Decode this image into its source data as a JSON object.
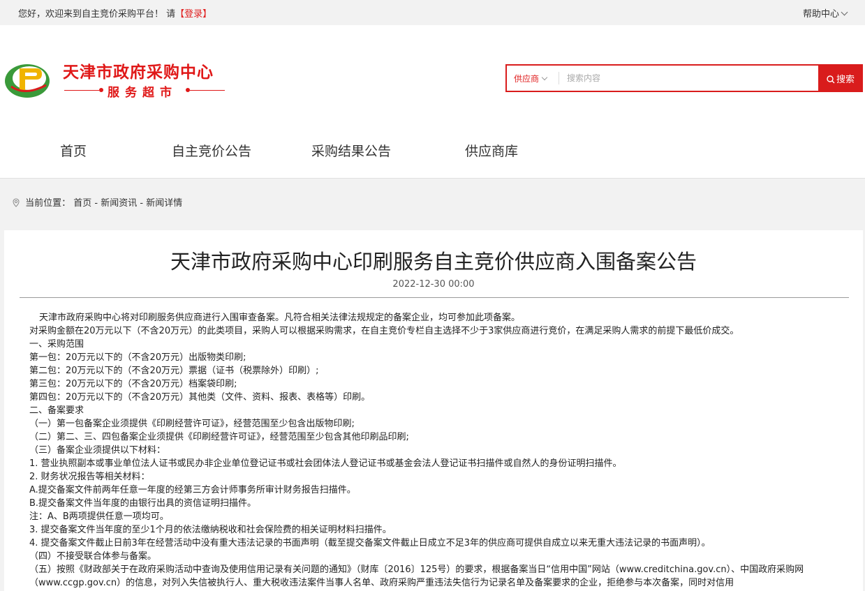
{
  "topbar": {
    "welcome": "您好，欢迎来到自主竞价采购平台！ 请",
    "login": "【登录】",
    "help": "帮助中心"
  },
  "logo": {
    "title": "天津市政府采购中心",
    "subtitle": "服务超市"
  },
  "search": {
    "scope": "供应商",
    "placeholder": "搜索内容",
    "button": "搜索"
  },
  "nav": [
    "首页",
    "自主竞价公告",
    "采购结果公告",
    "供应商库"
  ],
  "breadcrumb": {
    "label": "当前位置：",
    "path": "首页 - 新闻资讯 - 新闻详情"
  },
  "article": {
    "title": "天津市政府采购中心印刷服务自主竞价供应商入围备案公告",
    "date": "2022-12-30 00:00",
    "paragraphs": [
      "天津市政府采购中心将对印刷服务供应商进行入围审查备案。凡符合相关法律法规规定的备案企业，均可参加此项备案。",
      "对采购金额在20万元以下（不含20万元）的此类项目，采购人可以根据采购需求，在自主竞价专栏自主选择不少于3家供应商进行竞价，在满足采购人需求的前提下最低价成交。",
      "一、采购范围",
      "第一包：20万元以下的（不含20万元）出版物类印刷;",
      "第二包：20万元以下的（不含20万元）票据（证书（税票除外）印刷）;",
      "第三包：20万元以下的（不含20万元）档案袋印刷;",
      "第四包：20万元以下的（不含20万元）其他类（文件、资料、报表、表格等）印刷。",
      "二、备案要求",
      "（一）第一包备案企业须提供《印刷经营许可证》，经营范围至少包含出版物印刷;",
      "（二）第二、三、四包备案企业须提供《印刷经营许可证》，经营范围至少包含其他印刷品印刷;",
      "（三）备案企业须提供以下材料：",
      "1. 营业执照副本或事业单位法人证书或民办非企业单位登记证书或社会团体法人登记证书或基金会法人登记证书扫描件或自然人的身份证明扫描件。",
      "2. 财务状况报告等相关材料：",
      "A.提交备案文件前两年任意一年度的经第三方会计师事务所审计财务报告扫描件。",
      "B.提交备案文件当年度的由银行出具的资信证明扫描件。",
      "注：A、B两项提供任意一项均可。",
      "3. 提交备案文件当年度的至少1个月的依法缴纳税收和社会保险费的相关证明材料扫描件。",
      "4. 提交备案文件截止日前3年在经营活动中没有重大违法记录的书面声明（截至提交备案文件截止日成立不足3年的供应商可提供自成立以来无重大违法记录的书面声明）。",
      "（四）不接受联合体参与备案。",
      "（五）按照《财政部关于在政府采购活动中查询及使用信用记录有关问题的通知》（财库〔2016〕125号）的要求，根据备案当日“信用中国”网站（www.creditchina.gov.cn）、中国政府采购网（www.ccgp.gov.cn）的信息，对列入失信被执行人、重大税收违法案件当事人名单、政府采购严重违法失信行为记录名单及备案要求的企业，拒绝参与本次备案，同时对信用"
    ]
  }
}
